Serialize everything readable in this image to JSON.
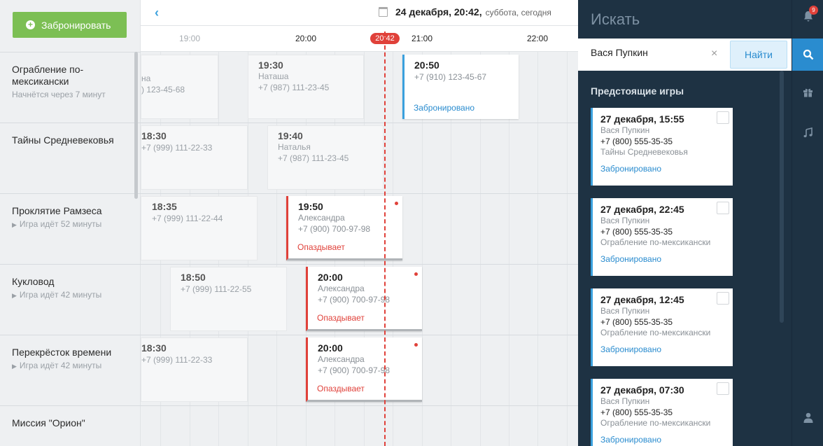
{
  "book_button": {
    "label": "Забронировать"
  },
  "header": {
    "date_main": "24 декабря, 20:42,",
    "date_sub": "суббота, сегодня"
  },
  "timeline": {
    "labels": [
      "19:00",
      "20:00",
      "21:00",
      "22:00"
    ],
    "now": "20:42"
  },
  "rooms": [
    {
      "name": "Ограбление по-мексикански",
      "status": "Начнётся через 7 минут"
    },
    {
      "name": "Тайны Средневековья",
      "status": ""
    },
    {
      "name": "Проклятие Рамзеса",
      "status": "Игра идёт 52 минуты"
    },
    {
      "name": "Кукловод",
      "status": "Игра идёт 42 минуты"
    },
    {
      "name": "Перекрёсток времени",
      "status": "Игра идёт 42 минуты"
    },
    {
      "name": "Миссия \"Орион\"",
      "status": ""
    }
  ],
  "bookings": {
    "r1a": {
      "name": "на",
      "phone": ") 123-45-68"
    },
    "r1b": {
      "time": "19:30",
      "name": "Наташа",
      "phone": "+7 (987) 111-23-45"
    },
    "r1c": {
      "time": "20:50",
      "phone": "+7 (910) 123-45-67",
      "status": "Забронировано"
    },
    "r2a": {
      "time": "18:30",
      "phone": "+7 (999) 111-22-33"
    },
    "r2b": {
      "time": "19:40",
      "name": "Наталья",
      "phone": "+7 (987) 111-23-45"
    },
    "r3a": {
      "time": "18:35",
      "phone": "+7 (999) 111-22-44"
    },
    "r3b": {
      "time": "19:50",
      "name": "Александра",
      "phone": "+7 (900) 700-97-98",
      "status": "Опаздывает"
    },
    "r4a": {
      "time": "18:50",
      "phone": "+7 (999) 111-22-55"
    },
    "r4b": {
      "time": "20:00",
      "name": "Александра",
      "phone": "+7 (900) 700-97-98",
      "status": "Опаздывает"
    },
    "r5a": {
      "time": "18:30",
      "phone": "+7 (999) 111-22-33"
    },
    "r5b": {
      "time": "20:00",
      "name": "Александра",
      "phone": "+7 (900) 700-97-98",
      "status": "Опаздывает"
    }
  },
  "search": {
    "title": "Искать",
    "value": "Вася Пупкин",
    "clear": "×",
    "button": "Найти",
    "section_title": "Предстоящие игры"
  },
  "games": [
    {
      "date": "27 декабря, 15:55",
      "name": "Вася Пупкин",
      "phone": "+7 (800) 555-35-35",
      "room": "Тайны Средневековья",
      "status": "Забронировано"
    },
    {
      "date": "27 декабря, 22:45",
      "name": "Вася Пупкин",
      "phone": "+7 (800) 555-35-35",
      "room": "Ограбление по-мексикански",
      "status": "Забронировано"
    },
    {
      "date": "27 декабря, 12:45",
      "name": "Вася Пупкин",
      "phone": "+7 (800) 555-35-35",
      "room": "Ограбление по-мексикански",
      "status": "Забронировано"
    },
    {
      "date": "27 декабря, 07:30",
      "name": "Вася Пупкин",
      "phone": "+7 (800) 555-35-35",
      "room": "Ограбление по-мексикански",
      "status": "Забронировано"
    }
  ],
  "rail": {
    "notification_count": "9",
    "icons": [
      "bell-icon",
      "search-icon",
      "gift-icon",
      "music-icon",
      "user-icon"
    ]
  },
  "colors": {
    "accent_green": "#7cbf54",
    "accent_blue": "#3aa0dd",
    "late_red": "#e0413a",
    "panel_dark": "#1e3243"
  }
}
